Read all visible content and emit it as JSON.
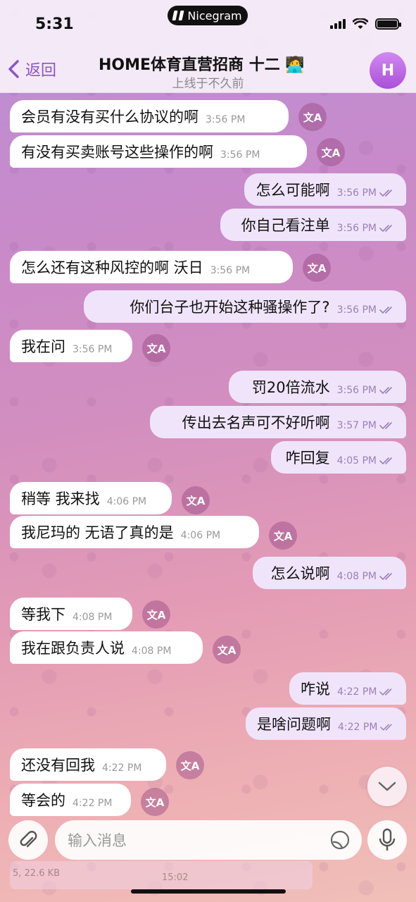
{
  "status_bar": {
    "time": "5:31",
    "island_label": "Nicegram"
  },
  "header": {
    "back_label": "返回",
    "title": "HOME体育直营招商 十二 🧑‍💻",
    "subtitle": "上线于不久前",
    "avatar_initial": "H"
  },
  "translate_glyph": "文A",
  "messages": [
    {
      "dir": "in",
      "text": "会员有没有买什么协议的啊",
      "time": "3:56 PM"
    },
    {
      "dir": "in",
      "text": "有没有买卖账号这些操作的啊",
      "time": "3:56 PM"
    },
    {
      "dir": "out",
      "text": "怎么可能啊",
      "time": "3:56 PM"
    },
    {
      "dir": "out",
      "text": "你自己看注单",
      "time": "3:56 PM"
    },
    {
      "dir": "in",
      "text": "怎么还有这种风控的啊 沃日",
      "time": "3:56 PM"
    },
    {
      "dir": "out",
      "text": "你们台子也开始这种骚操作了?",
      "time": "3:56 PM"
    },
    {
      "dir": "in",
      "text": "我在问",
      "time": "3:56 PM"
    },
    {
      "dir": "out",
      "text": "罚20倍流水",
      "time": "3:56 PM"
    },
    {
      "dir": "out",
      "text": "传出去名声可不好听啊",
      "time": "3:57 PM"
    },
    {
      "dir": "out",
      "text": "咋回复",
      "time": "4:05 PM"
    },
    {
      "dir": "in",
      "text": "稍等 我来找",
      "time": "4:06 PM"
    },
    {
      "dir": "in",
      "text": "我尼玛的 无语了真的是",
      "time": "4:06 PM"
    },
    {
      "dir": "out",
      "text": "怎么说啊",
      "time": "4:08 PM"
    },
    {
      "dir": "in",
      "text": "等我下",
      "time": "4:08 PM"
    },
    {
      "dir": "in",
      "text": "我在跟负责人说",
      "time": "4:08 PM"
    },
    {
      "dir": "out",
      "text": "咋说",
      "time": "4:22 PM"
    },
    {
      "dir": "out",
      "text": "是啥问题啊",
      "time": "4:22 PM"
    },
    {
      "dir": "in",
      "text": "还没有回我",
      "time": "4:22 PM"
    },
    {
      "dir": "in",
      "text": "等会的",
      "time": "4:22 PM"
    }
  ],
  "input": {
    "placeholder": "输入消息"
  },
  "preview": {
    "size_text": "5, 22.6 KB",
    "time_text": "15:02"
  }
}
